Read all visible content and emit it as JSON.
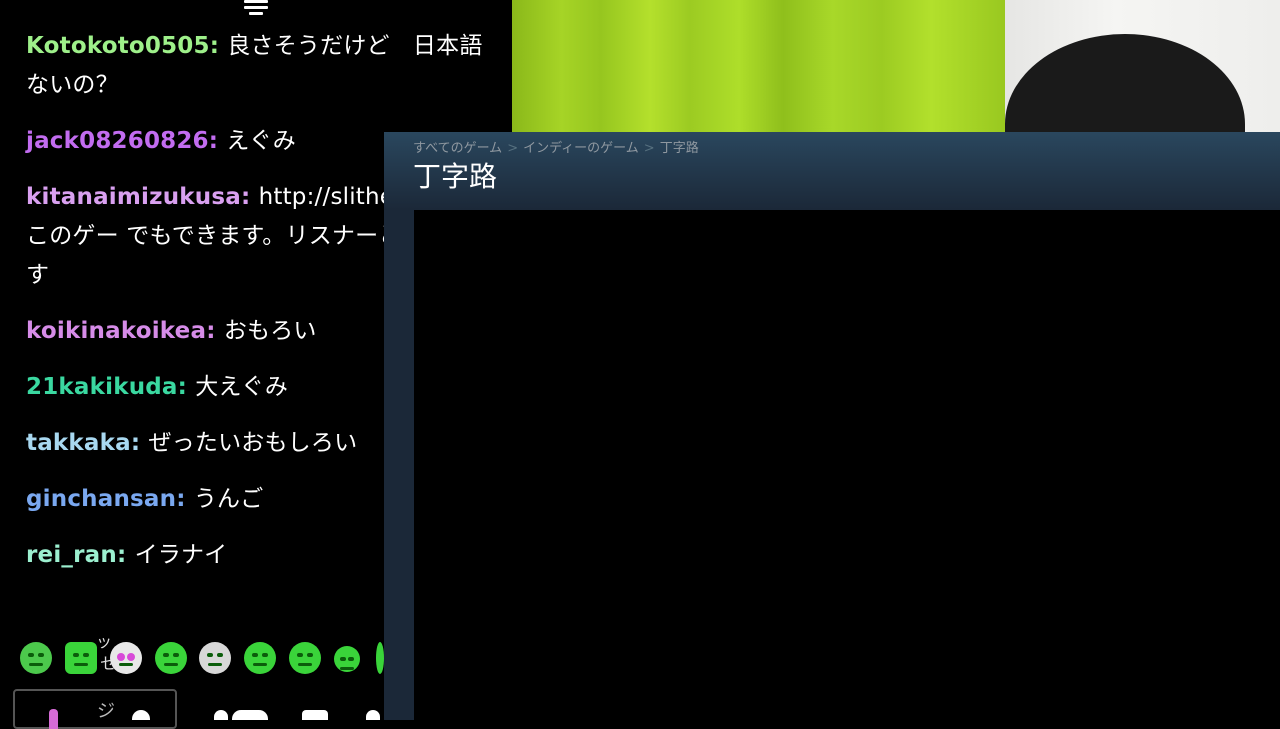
{
  "chat": {
    "messages": [
      {
        "user": "Kotokoto0505",
        "color": "#9ef08a",
        "text": "良さそうだけど　日本語ないの？"
      },
      {
        "user": "jack08260826",
        "color": "#c26cf0",
        "text": "えぐみ"
      },
      {
        "user": "kitanaimizukusa",
        "color": "#d9a0f0",
        "text": "http://slither.com/io　このゲー でもできます。リスナーと一緒 ます"
      },
      {
        "user": "koikinakoikea",
        "color": "#d68ce8",
        "text": "おもろい"
      },
      {
        "user": "21kakikuda",
        "color": "#3ad8a0",
        "text": "大えぐみ"
      },
      {
        "user": "takkaka",
        "color": "#a8d8f0",
        "text": "ぜったいおもしろい"
      },
      {
        "user": "ginchansan",
        "color": "#7aa8f0",
        "text": "うんご"
      },
      {
        "user": "rei_ran",
        "color": "#9cf0d0",
        "text": "イラナイ"
      }
    ],
    "stray_chars": [
      "ッ",
      "セ"
    ],
    "input_partial": "ジ"
  },
  "steam": {
    "breadcrumb": [
      "すべてのゲーム",
      "インディーのゲーム",
      "丁字路"
    ],
    "breadcrumb_sep": ">",
    "title": "丁字路"
  }
}
